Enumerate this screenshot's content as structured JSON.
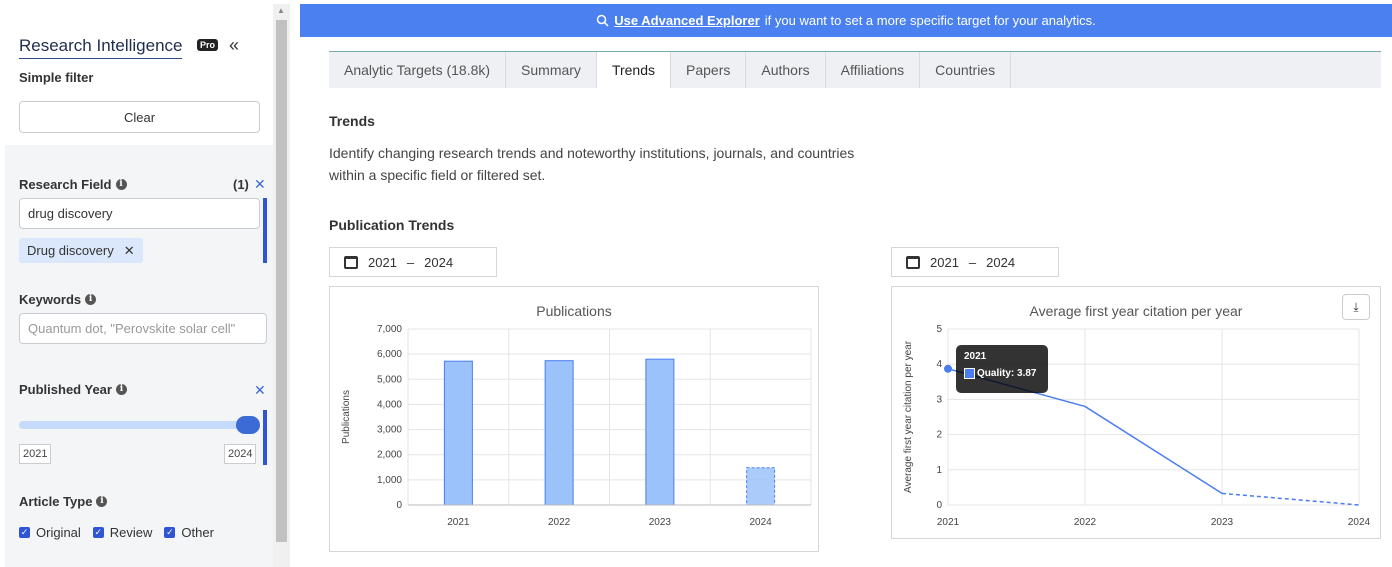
{
  "sidebar": {
    "brand": "Research Intelligence",
    "pro_badge": "Pro",
    "collapse_icon": "«",
    "simple_filter": "Simple filter",
    "clear_label": "Clear",
    "research_field": {
      "label": "Research Field",
      "count": "(1)",
      "input_value": "drug discovery",
      "chip": "Drug discovery"
    },
    "keywords": {
      "label": "Keywords",
      "placeholder": "Quantum dot, \"Perovskite solar cell\""
    },
    "published_year": {
      "label": "Published Year",
      "min": "2021",
      "max": "2024",
      "slider_fraction": 1.0
    },
    "article_type": {
      "label": "Article Type",
      "options": [
        "Original",
        "Review",
        "Other"
      ]
    }
  },
  "banner": {
    "link": "Use Advanced Explorer",
    "text": "if you want to set a more specific target for your analytics."
  },
  "tabs": [
    "Analytic Targets (18.8k)",
    "Summary",
    "Trends",
    "Papers",
    "Authors",
    "Affiliations",
    "Countries"
  ],
  "active_tab": "Trends",
  "main": {
    "title": "Trends",
    "description_line1": "Identify changing research trends and noteworthy institutions, journals, and countries",
    "description_line2": "within a specific field or filtered set.",
    "section_title": "Publication Trends",
    "range_left": {
      "from": "2021",
      "sep": "–",
      "to": "2024"
    },
    "range_right": {
      "from": "2021",
      "sep": "–",
      "to": "2024"
    }
  },
  "tooltip": {
    "title": "2021",
    "label": "Quality: 3.87"
  },
  "colors": {
    "accent": "#4a80f0",
    "bar": "#9cc2fa",
    "bar_border": "#4a7df0",
    "line": "#4a7df0"
  },
  "chart_data": [
    {
      "type": "bar",
      "title": "Publications",
      "ylabel": "Publications",
      "xlabel": "",
      "categories": [
        "2021",
        "2022",
        "2023",
        "2024"
      ],
      "values": [
        5720,
        5740,
        5800,
        1480
      ],
      "partial_last": true,
      "ylim": [
        0,
        7000
      ],
      "yticks": [
        "0",
        "1,000",
        "2,000",
        "3,000",
        "4,000",
        "5,000",
        "6,000",
        "7,000"
      ],
      "grid": true
    },
    {
      "type": "line",
      "title": "Average first year citation per year",
      "ylabel": "Average first year citation per year",
      "xlabel": "",
      "categories": [
        "2021",
        "2022",
        "2023",
        "2024"
      ],
      "values": [
        3.87,
        2.8,
        0.33,
        0.0
      ],
      "partial_last": true,
      "ylim": [
        0,
        5
      ],
      "yticks": [
        "0",
        "1",
        "2",
        "3",
        "4",
        "5"
      ],
      "grid": true
    }
  ]
}
